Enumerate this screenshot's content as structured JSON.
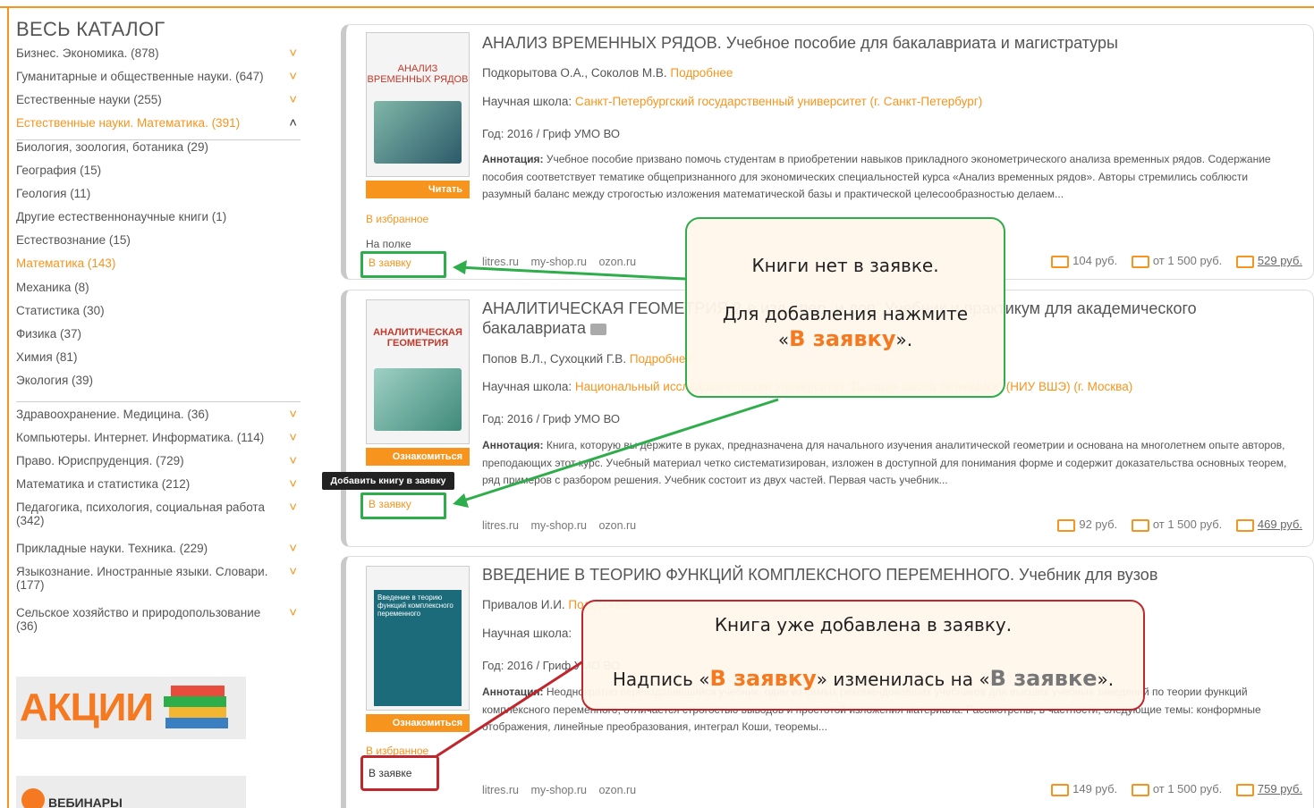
{
  "catalog": {
    "title": "ВЕСЬ КАТАЛОГ",
    "items": [
      {
        "label": "Бизнес. Экономика. (878)",
        "chev": "down"
      },
      {
        "label": "Гуманитарные и общественные науки. (647)",
        "chev": "down"
      },
      {
        "label": "Естественные науки (255)",
        "chev": "down"
      },
      {
        "label": "Естественные науки. Математика. (391)",
        "chev": "up",
        "active": true
      },
      {
        "label": "Биология, зоология, ботаника (29)"
      },
      {
        "label": "География (15)"
      },
      {
        "label": "Геология (11)"
      },
      {
        "label": "Другие естественнонаучные книги (1)"
      },
      {
        "label": "Естествознание (15)"
      },
      {
        "label": "Математика (143)",
        "active_sub": true
      },
      {
        "label": "Механика (8)"
      },
      {
        "label": "Статистика (30)"
      },
      {
        "label": "Физика (37)"
      },
      {
        "label": "Химия (81)"
      },
      {
        "label": "Экология (39)"
      },
      {
        "label": "Здравоохранение. Медицина. (36)",
        "chev": "down"
      },
      {
        "label": "Компьютеры. Интернет. Информатика. (114)",
        "chev": "down"
      },
      {
        "label": "Право. Юриспруденция. (729)",
        "chev": "down"
      },
      {
        "label": "Математика и статистика (212)",
        "chev": "down"
      },
      {
        "label": "Педагогика, психология, социальная работа (342)",
        "chev": "down"
      },
      {
        "label": "Прикладные науки. Техника. (229)",
        "chev": "down"
      },
      {
        "label": "Языкознание. Иностранные языки. Словари. (177)",
        "chev": "down"
      },
      {
        "label": "Сельское хозяйство и природопользование (36)",
        "chev": "down"
      }
    ],
    "promo1": "АКЦИИ",
    "promo2": "ВЕБИНАРЫ"
  },
  "books": [
    {
      "cover_title": "АНАЛИЗ ВРЕМЕННЫХ РЯДОВ",
      "read_label": "Читать",
      "fav": "В избранное",
      "shelf": "На полке",
      "request": "В заявку",
      "title": "АНАЛИЗ ВРЕМЕННЫХ РЯДОВ. Учебное пособие для бакалавриата и магистратуры",
      "authors": "Подкорытова О.А., Соколов М.В.",
      "more": "Подробнее",
      "school_label": "Научная школа:",
      "school": "Санкт-Петербургский государственный университет (г. Санкт-Петербург)",
      "year": "Год: 2016 / Гриф УМО ВО",
      "ann_label": "Аннотация:",
      "annotation": "Учебное пособие призвано помочь студентам в приобретении навыков прикладного эконометрического анализа временных рядов. Содержание пособия соответствует тематике общепризнанного для экономических специальностей курса «Анализ временных рядов». Авторы стремились соблюсти разумный баланс между строгостью изложения математической базы и практической целесообразностью делаем...",
      "stores": "litres.ru my-shop.ru ozon.ru",
      "price1": "104 руб.",
      "price2": "от 1 500 руб.",
      "price3": "529 руб."
    },
    {
      "cover_title": "АНАЛИТИЧЕСКАЯ ГЕОМЕТРИЯ",
      "read_label": "Ознакомиться",
      "request": "В заявку",
      "title": "АНАЛИТИЧЕСКАЯ ГЕОМЕТРИЯ 2-е изд., пер. и доп. Учебник и практикум для академического",
      "title2": "бакалавриата",
      "authors": "Попов В.Л., Сухоцкий Г.В.",
      "more": "Подробнее",
      "school_label": "Научная школа:",
      "school": "Национальный исследовательский университет \"Высшая школа экономики\" (НИУ ВШЭ) (г. Москва)",
      "year": "Год: 2016 / Гриф УМО ВО",
      "ann_label": "Аннотация:",
      "annotation": "Книга, которую вы держите в руках, предназначена для начального изучения аналитической геометрии и основана на многолетнем опыте авторов, преподающих этот курс. Учебный материал четко систематизирован, изложен в доступной для понимания форме и содержит доказательства основных теорем, ряд примеров с разбором решения. Учебник состоит из двух частей. Первая часть учебник...",
      "stores": "litres.ru my-shop.ru ozon.ru",
      "price1": "92 руб.",
      "price2": "от 1 500 руб.",
      "price3": "469 руб."
    },
    {
      "cover_title": "Введение в теорию функций комплексного переменного",
      "read_label": "Ознакомиться",
      "fav": "В избранное",
      "request": "В заявке",
      "title": "ВВЕДЕНИЕ В ТЕОРИЮ ФУНКЦИЙ КОМПЛЕКСНОГО ПЕРЕМЕННОГО. Учебник для вузов",
      "authors": "Привалов И.И.",
      "more": "Подробнее",
      "school_label": "Научная школа:",
      "year": "Год: 2016 / Гриф УМО ВО",
      "ann_label": "Аннотация:",
      "annotation": "Неоднократно переиздававшийся учебник, один из самых рекомендовавших учебников для высших учебных заведений по теории функций комплексного переменного, отличается строгостью выводов и простотой изложения материала. Рассмотрены, в частности, следующие темы: конформные отображения, линейные преобразования, интеграл Коши, теоремы...",
      "stores": "litres.ru my-shop.ru ozon.ru",
      "price1": "149 руб.",
      "price2": "от 1 500 руб.",
      "price3": "759 руб."
    }
  ],
  "tooltip": "Добавить книгу в заявку",
  "callout_green": {
    "line1": "Книги нет в заявке.",
    "line2": "Для добавления нажмите",
    "quote_open": "«",
    "emph": "В заявку",
    "quote_close": "»."
  },
  "callout_red": {
    "line1": "Книга уже добавлена в заявку.",
    "pre": "Надпись «",
    "emph1": "В заявку",
    "mid": "» изменилась на «",
    "emph2": "В заявке",
    "post": "»."
  },
  "colors": {
    "accent": "#f7941d",
    "green": "#2ead4b",
    "red": "#c0272d"
  }
}
